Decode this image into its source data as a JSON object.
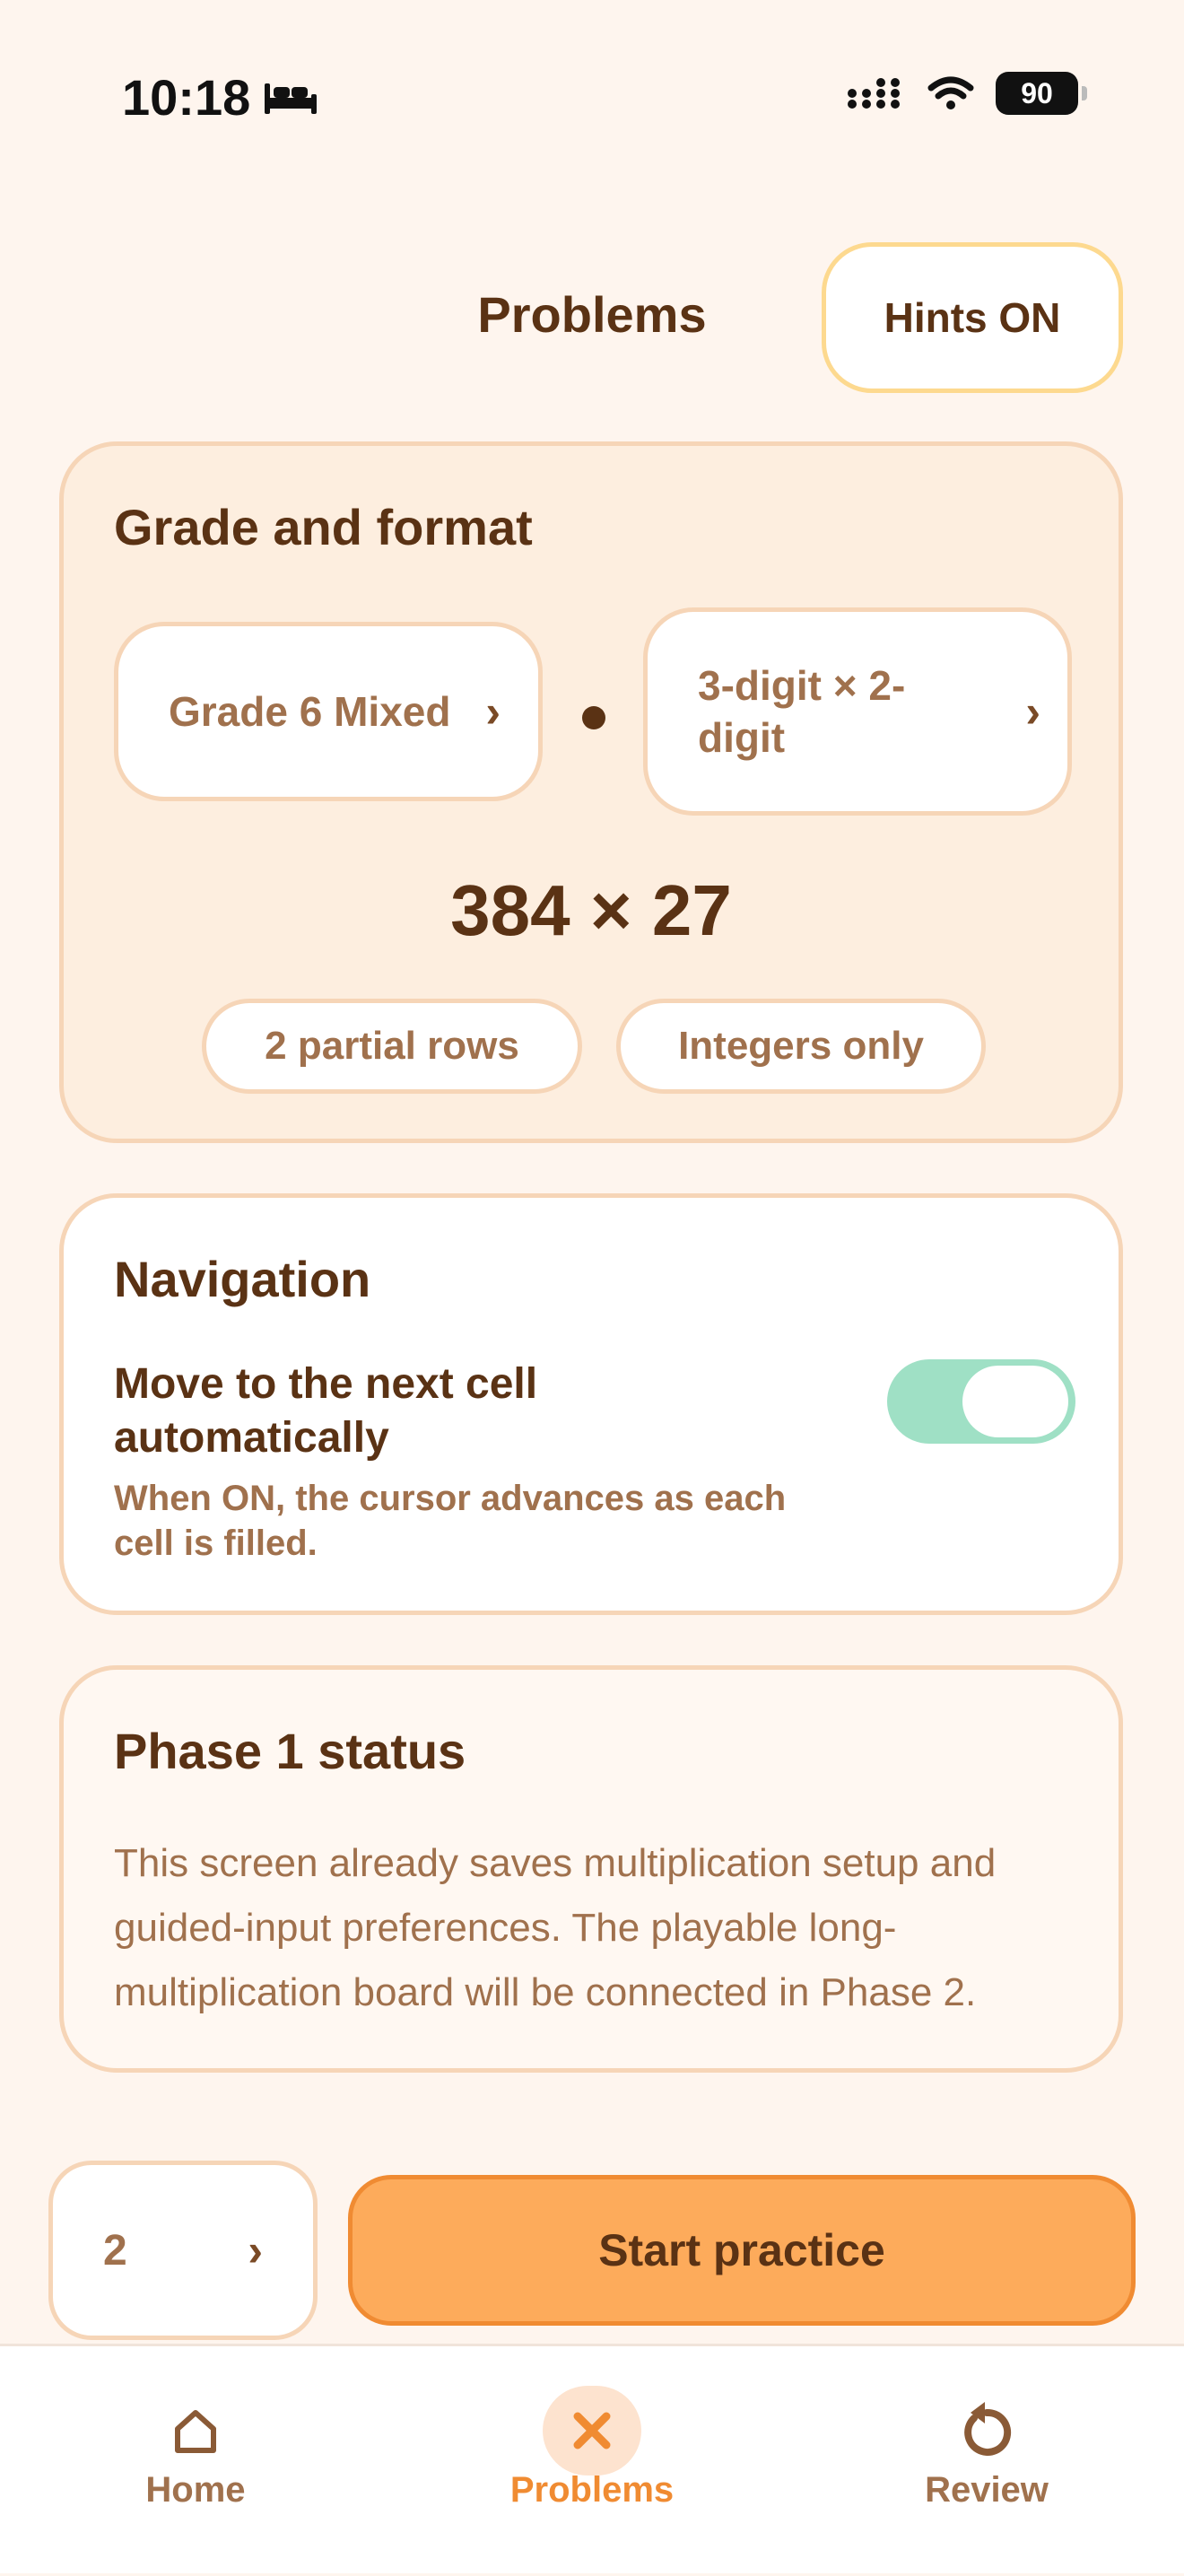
{
  "status_bar": {
    "time": "10:18",
    "battery": "90"
  },
  "header": {
    "title": "Problems",
    "hints_button": "Hints ON"
  },
  "grade_card": {
    "title": "Grade and format",
    "grade_selector": "Grade 6 Mixed",
    "format_selector": "3-digit × 2-digit",
    "problem": "384 × 27",
    "pills": [
      "2 partial rows",
      "Integers only"
    ]
  },
  "navigation_card": {
    "title": "Navigation",
    "setting_label": "Move to the next cell automatically",
    "setting_description": "When ON, the cursor advances as each cell is filled.",
    "toggle_on": true
  },
  "phase_card": {
    "title": "Phase 1 status",
    "text": "This screen already saves multiplication setup and guided-input preferences. The playable long-multiplication board will be connected in Phase 2."
  },
  "bottom": {
    "count_value": "2",
    "start_button": "Start practice"
  },
  "tabs": [
    {
      "label": "Home",
      "icon": "home-icon"
    },
    {
      "label": "Problems",
      "icon": "close-x-icon",
      "active": true
    },
    {
      "label": "Review",
      "icon": "rotate-refresh-icon"
    }
  ],
  "colors": {
    "background": "#fef5ee",
    "accent": "#f08b32",
    "primary_button": "#fdab5b",
    "toggle_on": "#9fe0c5",
    "text_dark": "#5a3214",
    "text_muted": "#a0714d"
  }
}
